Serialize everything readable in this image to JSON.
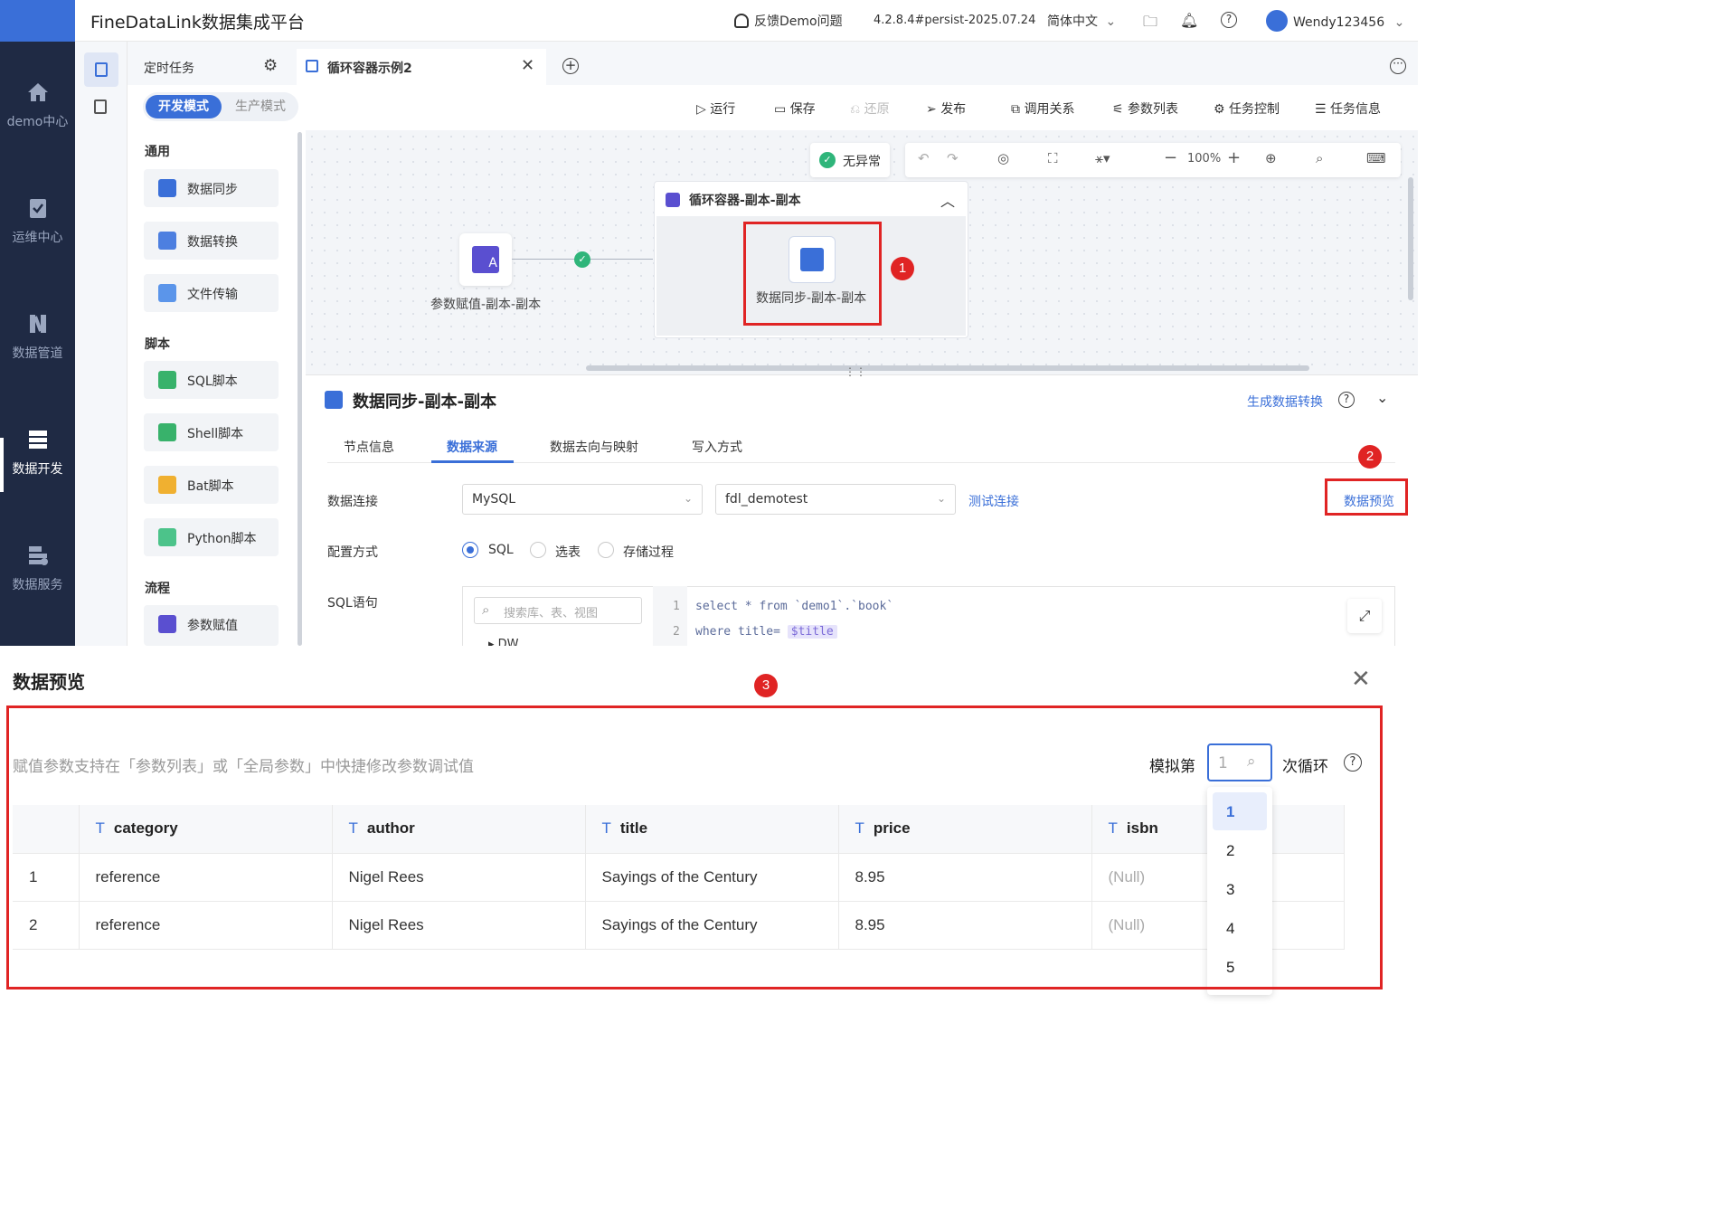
{
  "app": {
    "title": "FineDataLink数据集成平台"
  },
  "topbar": {
    "feedback": "反馈Demo问题",
    "version": "4.2.8.4#persist-2025.07.24",
    "language": "简体中文",
    "user": "Wendy123456"
  },
  "sidebar": {
    "items": [
      {
        "label": "demo中心",
        "icon": "home-icon"
      },
      {
        "label": "运维中心",
        "icon": "clipboard-check-icon"
      },
      {
        "label": "数据管道",
        "icon": "pipeline-icon"
      },
      {
        "label": "数据开发",
        "icon": "data-dev-icon"
      },
      {
        "label": "数据服务",
        "icon": "data-service-icon"
      }
    ]
  },
  "tabs": {
    "tab1": "定时任务",
    "tab2": "循环容器示例2"
  },
  "mode": {
    "dev": "开发模式",
    "prod": "生产模式"
  },
  "panel": {
    "groups": {
      "general": "通用",
      "script": "脚本",
      "flow": "流程"
    },
    "general": [
      "数据同步",
      "数据转换",
      "文件传输"
    ],
    "script": [
      "SQL脚本",
      "Shell脚本",
      "Bat脚本",
      "Python脚本"
    ],
    "flow": [
      "参数赋值"
    ]
  },
  "toolbar": {
    "run": "运行",
    "save": "保存",
    "restore": "还原",
    "publish": "发布",
    "relation": "调用关系",
    "params": "参数列表",
    "control": "任务控制",
    "info": "任务信息"
  },
  "canvas": {
    "status": "无异常",
    "zoom": "100%",
    "container_title": "循环容器-副本-副本",
    "node_param": "参数赋值-副本-副本",
    "node_sync": "数据同步-副本-副本"
  },
  "props": {
    "title": "数据同步-副本-副本",
    "gen_transform": "生成数据转换",
    "tabs": [
      "节点信息",
      "数据来源",
      "数据去向与映射",
      "写入方式"
    ],
    "labels": {
      "conn": "数据连接",
      "config": "配置方式",
      "sql": "SQL语句"
    },
    "db_type": "MySQL",
    "db_name": "fdl_demotest",
    "test_conn": "测试连接",
    "preview": "数据预览",
    "config_options": [
      "SQL",
      "选表",
      "存储过程"
    ],
    "search_placeholder": "搜索库、表、视图",
    "tree_item": "DW",
    "code_lines": [
      "select * from `demo1`.`book`",
      "where title= "
    ],
    "code_param": "$title"
  },
  "preview": {
    "title": "数据预览",
    "hint": "赋值参数支持在「参数列表」或「全局参数」中快捷修改参数调试值",
    "loop_prefix": "模拟第",
    "loop_suffix": "次循环",
    "loop_value": "1",
    "columns": [
      "category",
      "author",
      "title",
      "price",
      "isbn"
    ],
    "rows": [
      {
        "no": "1",
        "category": "reference",
        "author": "Nigel Rees",
        "title": "Sayings of the Century",
        "price": "8.95",
        "isbn": "(Null)"
      },
      {
        "no": "2",
        "category": "reference",
        "author": "Nigel Rees",
        "title": "Sayings of the Century",
        "price": "8.95",
        "isbn": "(Null)"
      }
    ],
    "dropdown": [
      "1",
      "2",
      "3",
      "4",
      "5"
    ]
  },
  "annotations": [
    "1",
    "2",
    "3"
  ],
  "colors": {
    "accent": "#3a6fd8",
    "sidebar": "#1f2a44",
    "marker": "#e02424",
    "success": "#2fb57a"
  }
}
